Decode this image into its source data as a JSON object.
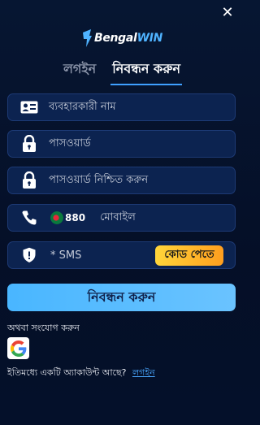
{
  "brand": {
    "part1": "Bengal",
    "part2": "WIN"
  },
  "tabs": [
    {
      "label": "লগইন",
      "active": false
    },
    {
      "label": "নিবন্ধন করুন",
      "active": true
    }
  ],
  "form": {
    "username_placeholder": "ব্যবহারকারী নাম",
    "password_placeholder": "পাসওয়ার্ড",
    "confirm_password_placeholder": "পাসওয়ার্ড নিশ্চিত করুন",
    "country_code": "880",
    "mobile_placeholder": "মোবাইল",
    "sms_placeholder": "* SMS",
    "get_code_label": "কোড পেতে"
  },
  "submit_label": "নিবন্ধন করুন",
  "or_connect_label": "অথবা সংযোগ করুন",
  "login_prompt": "ইতিমধ্যে একটি অ্যাকাউন্ট আছে?",
  "login_link": "লগইন",
  "icons": {
    "close": "close-icon",
    "username": "id-card-icon",
    "password": "lock-icon",
    "mobile": "phone-icon",
    "sms": "shield-icon",
    "flag": "bangladesh-flag-icon",
    "google": "google-icon"
  },
  "colors": {
    "accent": "#3fa0ff",
    "code_button": "#ffb22b",
    "submit_button": "#55bbff",
    "field_bg": "#0c2350"
  }
}
